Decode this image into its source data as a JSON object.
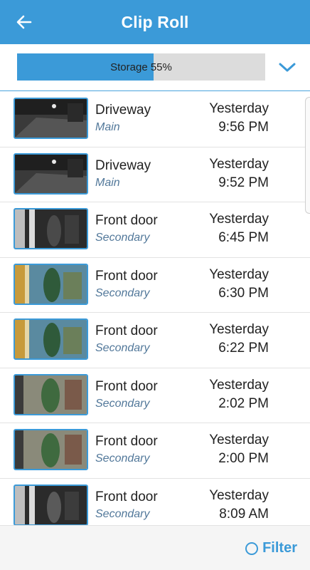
{
  "header": {
    "title": "Clip Roll",
    "back_icon": "arrow-left-icon",
    "background_color": "#3b9ad8"
  },
  "storage": {
    "label": "Storage 55%",
    "percent": 55,
    "fill_color": "#3b9ad8",
    "expand_icon": "chevron-down-icon"
  },
  "clips": [
    {
      "name": "Driveway",
      "camera": "Main",
      "day": "Yesterday",
      "time": "9:56 PM",
      "thumb": "night"
    },
    {
      "name": "Driveway",
      "camera": "Main",
      "day": "Yesterday",
      "time": "9:52 PM",
      "thumb": "night"
    },
    {
      "name": "Front door",
      "camera": "Secondary",
      "day": "Yesterday",
      "time": "6:45 PM",
      "thumb": "dusk"
    },
    {
      "name": "Front door",
      "camera": "Secondary",
      "day": "Yesterday",
      "time": "6:30 PM",
      "thumb": "day-warm"
    },
    {
      "name": "Front door",
      "camera": "Secondary",
      "day": "Yesterday",
      "time": "6:22 PM",
      "thumb": "day-warm"
    },
    {
      "name": "Front door",
      "camera": "Secondary",
      "day": "Yesterday",
      "time": "2:02 PM",
      "thumb": "day"
    },
    {
      "name": "Front door",
      "camera": "Secondary",
      "day": "Yesterday",
      "time": "2:00 PM",
      "thumb": "day"
    },
    {
      "name": "Front door",
      "camera": "Secondary",
      "day": "Yesterday",
      "time": "8:09 AM",
      "thumb": "morning-bw"
    }
  ],
  "footer": {
    "filter_label": "Filter",
    "filter_icon": "circle-icon",
    "accent_color": "#3b9ad8"
  }
}
